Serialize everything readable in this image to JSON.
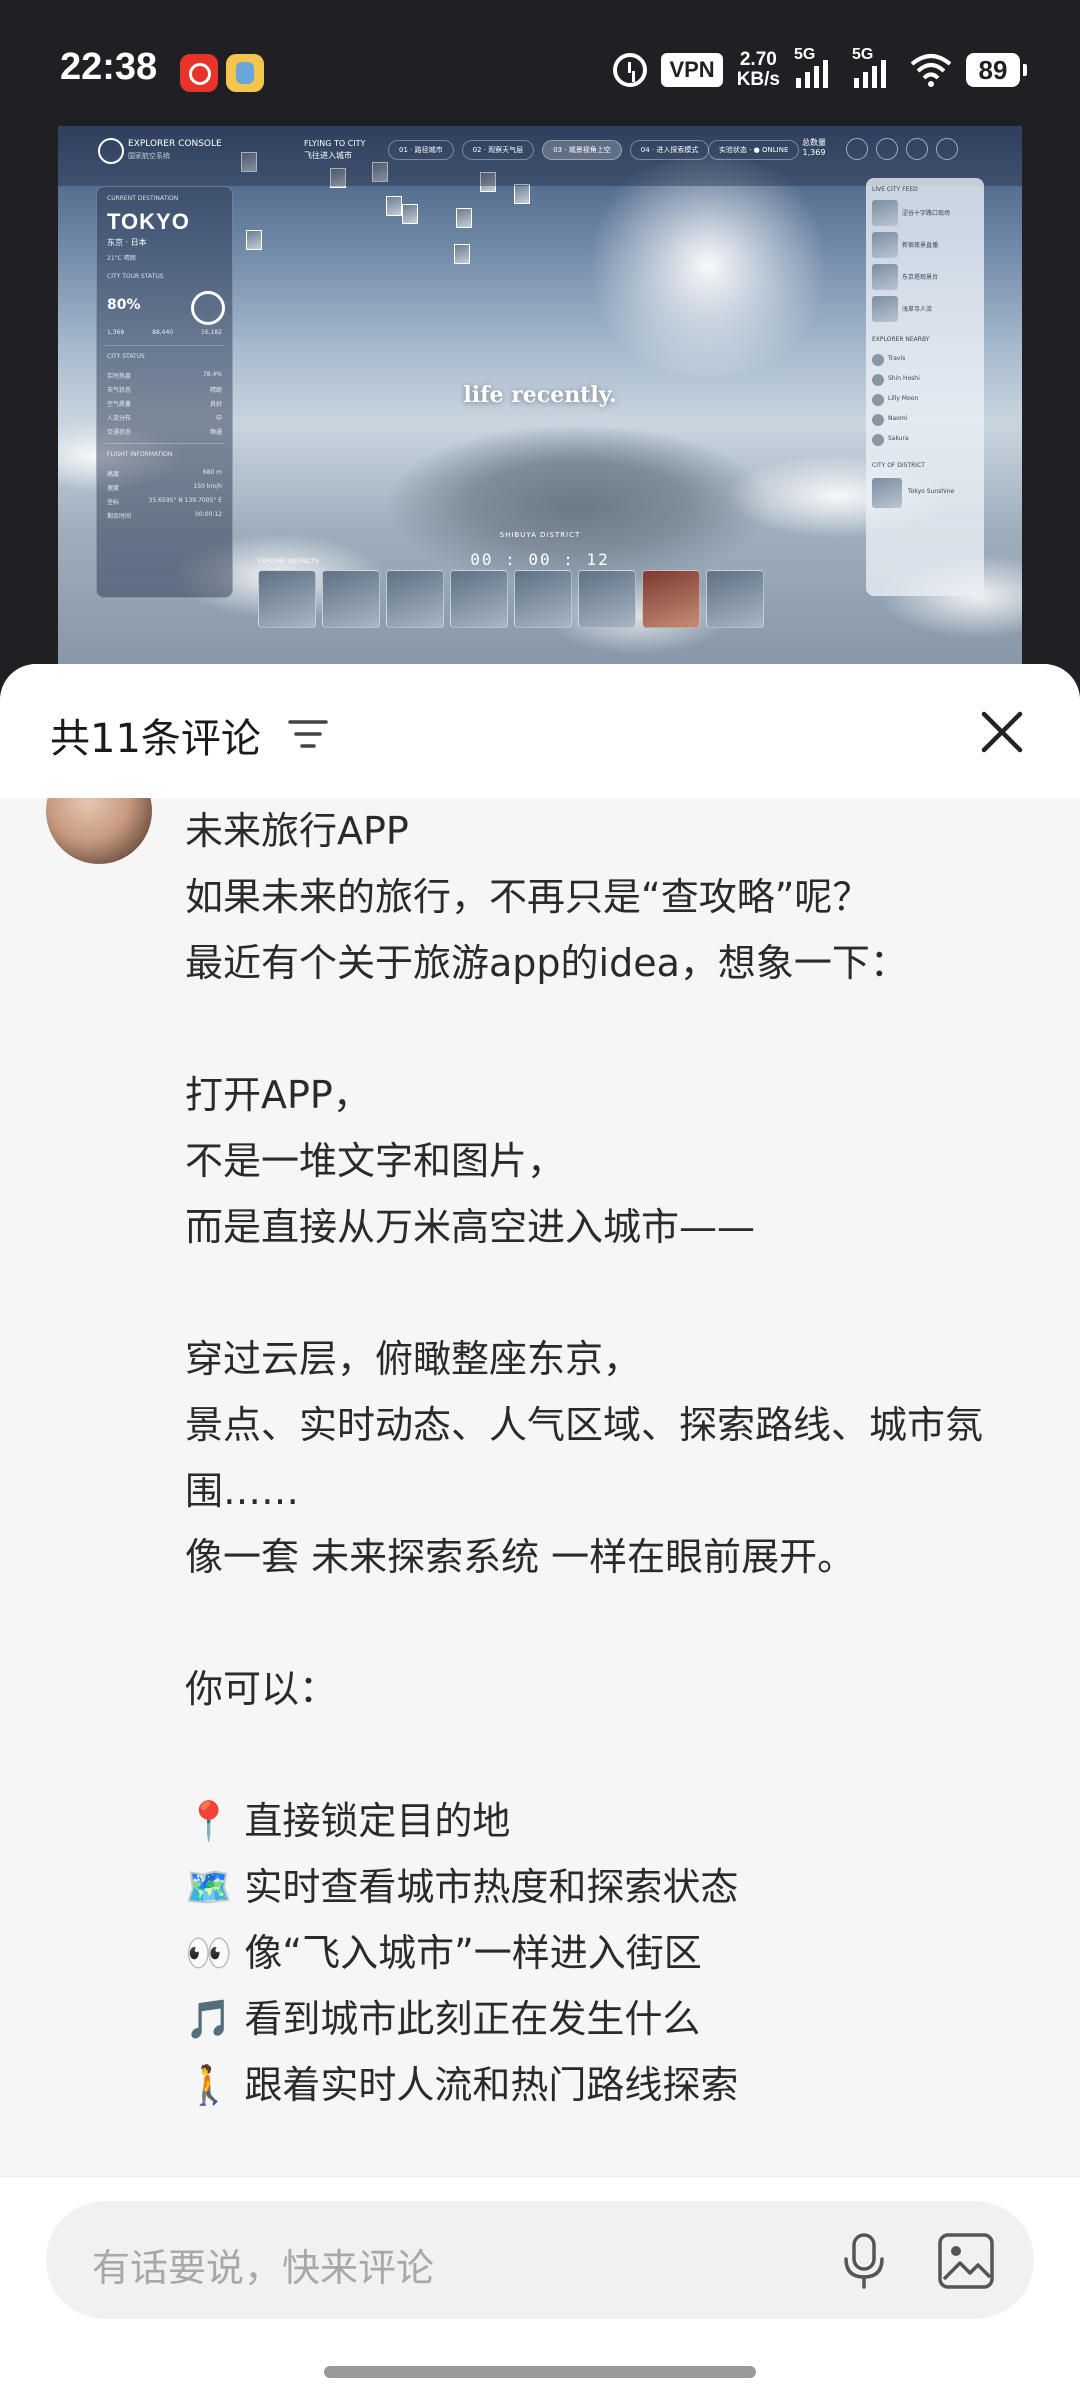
{
  "status_bar": {
    "time": "22:38",
    "vpn_label": "VPN",
    "speed_value": "2.70",
    "speed_unit": "KB/s",
    "network_1": "5G",
    "network_2": "5G",
    "battery": "89"
  },
  "preview": {
    "brand": "EXPLORER CONSOLE",
    "brand_sub": "国家航空系统",
    "flying": "FLYING TO CITY",
    "flying_sub": "飞往进入城市",
    "nav": [
      "01 · 路径城市",
      "02 · 观察天气层",
      "03 · 城景视角上空",
      "04 · 进入探索模式"
    ],
    "online": "实验状态 · ● ONLINE",
    "count_label": "总数量",
    "count_value": "1,369",
    "current_destination": "CURRENT DESTINATION",
    "city": "TOKYO",
    "city_sub": "东京 · 日本",
    "temp": "21°C 晴朗",
    "explore_status": "CITY TOUR STATUS",
    "percent": "80%",
    "stats": [
      [
        "1,368",
        "88,440",
        "16,182"
      ]
    ],
    "city_status": "CITY STATUS",
    "city_status_rows": [
      [
        "实时热度",
        "78.4%"
      ],
      [
        "天气状态",
        "晴朗"
      ],
      [
        "空气质量",
        "良好"
      ],
      [
        "人流分布",
        "中"
      ],
      [
        "交通状态",
        "畅通"
      ]
    ],
    "flight_info": "FLIGHT INFORMATION",
    "flight_rows": [
      [
        "高度",
        "680 m"
      ],
      [
        "速度",
        "150 km/h"
      ],
      [
        "坐标",
        "35.6595° N 139.7005° E"
      ],
      [
        "剩余时间",
        "00:00:12"
      ]
    ],
    "live_feed": "LIVE CITY FEED",
    "feed_items": [
      "涩谷十字路口现场",
      "新宿夜景直播",
      "东京塔观景台",
      "浅草寺人流"
    ],
    "explorers": "EXPLORER NEARBY",
    "explorer_names": [
      "Travis",
      "Shin Hoshi",
      "Lilly Moon",
      "Naomi",
      "Sakura"
    ],
    "city_of_district": "CITY OF DISTRICT",
    "district_card": "Tokyo Sunshine",
    "explore_district": "EXPLORE DISTRICTS",
    "district": "SHIBUYA DISTRICT",
    "timer": "00 : 00 : 12",
    "watermark": "life recently."
  },
  "sheet": {
    "title": "共11条评论",
    "post_lines": [
      "未来旅行APP",
      "如果未来的旅行，不再只是“查攻略”呢？",
      "最近有个关于旅游app的idea，想象一下：",
      "",
      "打开APP，",
      "不是一堆文字和图片，",
      "而是直接从万米高空进入城市——",
      "",
      "穿过云层，俯瞰整座东京，",
      "景点、实时动态、人气区域、探索路线、城市氛围……",
      "像一套 未来探索系统 一样在眼前展开。",
      "",
      "你可以：",
      "",
      "📍 直接锁定目的地",
      "🗺️ 实时查看城市热度和探索状态",
      "👀 像“飞入城市”一样进入街区",
      "🎵 看到城市此刻正在发生什么",
      "🚶 跟着实时人流和热门路线探索"
    ],
    "input_placeholder": "有话要说，快来评论"
  }
}
